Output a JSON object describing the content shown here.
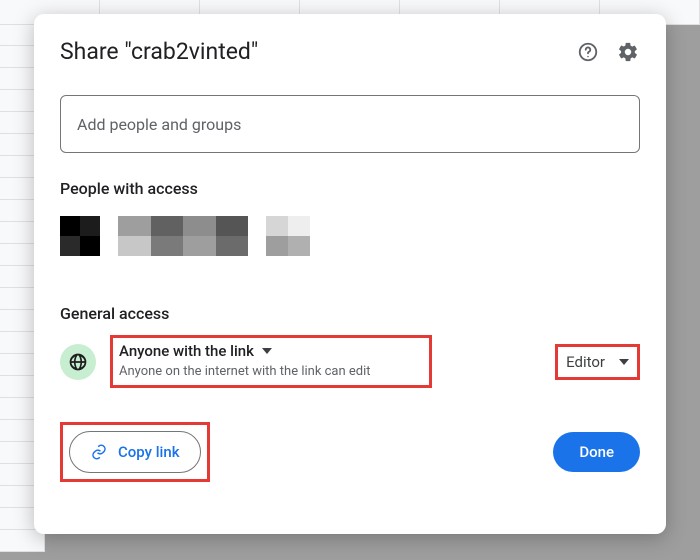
{
  "dialog": {
    "title": "Share \"crab2vinted\"",
    "input_placeholder": "Add people and groups",
    "people_heading": "People with access",
    "general_heading": "General access",
    "link_scope_label": "Anyone with the link",
    "link_scope_desc": "Anyone on the internet with the link can edit",
    "role_label": "Editor",
    "copy_link_label": "Copy link",
    "done_label": "Done"
  },
  "annotations": {
    "highlighted": [
      "link-scope-dropdown",
      "role-dropdown",
      "copy-link-button"
    ],
    "highlight_color": "#e53935"
  }
}
